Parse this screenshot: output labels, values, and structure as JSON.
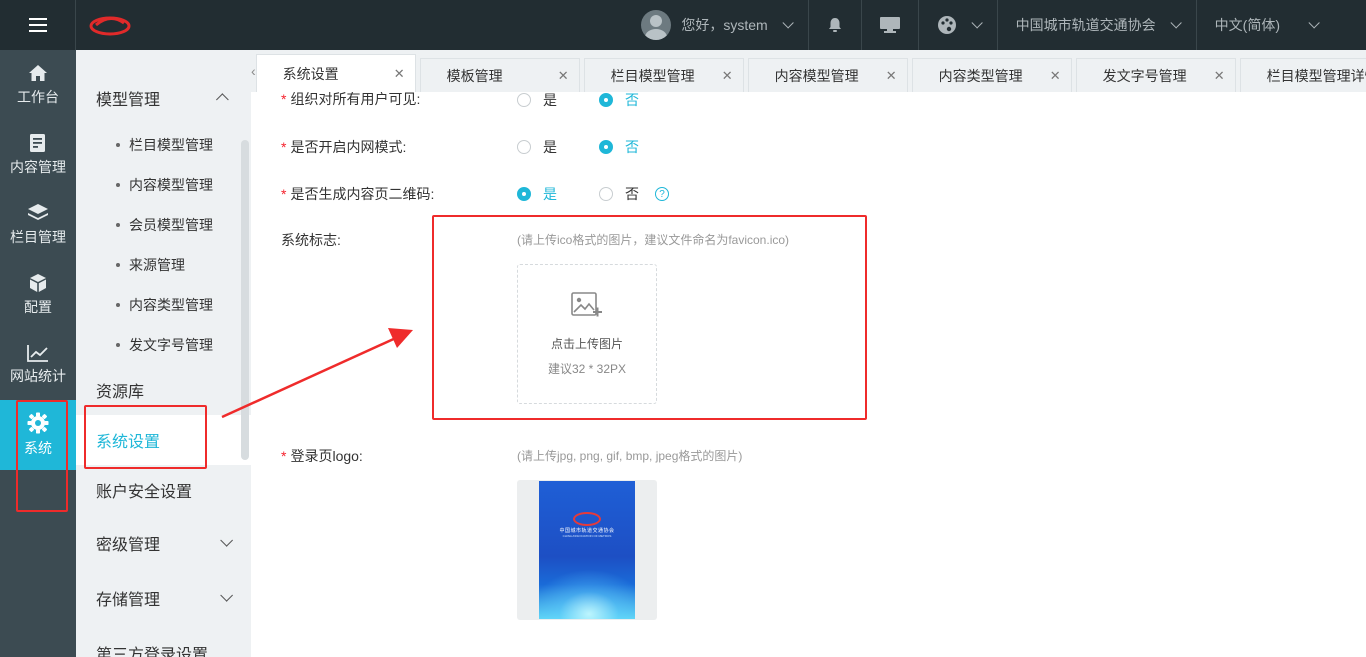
{
  "header": {
    "greeting": "您好，system",
    "organization": "中国城市轨道交通协会",
    "language": "中文(简体)",
    "icons": [
      "menu-icon",
      "bell-icon",
      "monitor-icon",
      "palette-icon"
    ]
  },
  "rail": {
    "items": [
      {
        "label": "工作台",
        "icon": "home-icon"
      },
      {
        "label": "内容管理",
        "icon": "document-icon"
      },
      {
        "label": "栏目管理",
        "icon": "layers-icon"
      },
      {
        "label": "配置",
        "icon": "cube-icon"
      },
      {
        "label": "网站统计",
        "icon": "chart-icon"
      },
      {
        "label": "系统",
        "icon": "gear-icon",
        "active": true
      }
    ]
  },
  "menu": {
    "group_model": "模型管理",
    "subitems": [
      "栏目模型管理",
      "内容模型管理",
      "会员模型管理",
      "来源管理",
      "内容类型管理",
      "发文字号管理"
    ],
    "resource": "资源库",
    "system_settings": "系统设置",
    "account_security": "账户安全设置",
    "secret_level": "密级管理",
    "storage": "存储管理",
    "third_party": "第三方登录设置"
  },
  "tabs": [
    {
      "label": "系统设置",
      "active": true
    },
    {
      "label": "模板管理"
    },
    {
      "label": "栏目模型管理"
    },
    {
      "label": "内容模型管理"
    },
    {
      "label": "内容类型管理"
    },
    {
      "label": "发文字号管理"
    },
    {
      "label": "栏目模型管理详情"
    }
  ],
  "form": {
    "org_visible_label": "组织对所有用户可见:",
    "intranet_label": "是否开启内网模式:",
    "qrcode_label": "是否生成内容页二维码:",
    "yes": "是",
    "no": "否",
    "org_visible_value": "否",
    "intranet_value": "否",
    "qrcode_value": "是",
    "help_mark": "?",
    "system_logo_label": "系统标志:",
    "system_logo_hint": "(请上传ico格式的图片，建议文件命名为favicon.ico)",
    "upload_text": "点击上传图片",
    "upload_size": "建议32 * 32PX",
    "login_logo_label": "登录页logo:",
    "login_logo_hint": "(请上传jpg, png, gif, bmp, jpeg格式的图片)",
    "poster_title": "中国城市轨道交通协会",
    "poster_sub": "CHINA ASSOCIATION OF METROS"
  },
  "colors": {
    "accent": "#1fb7d8",
    "topbar": "#222d32",
    "rail": "#3c4b52",
    "annotation": "#ef2b2b"
  }
}
